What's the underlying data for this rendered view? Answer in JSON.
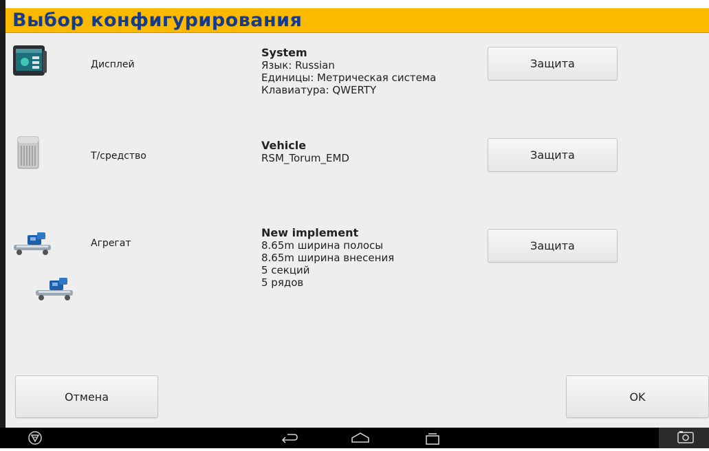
{
  "window": {
    "title": "Выбор конфигурирования"
  },
  "rows": [
    {
      "icon": "display-icon",
      "label": "Дисплей",
      "heading": "System",
      "lines": [
        "Язык: Russian",
        "Единицы: Метрическая система",
        "Клавиатура: QWERTY"
      ],
      "button": "Защита"
    },
    {
      "icon": "vehicle-icon",
      "label": "Т/средство",
      "heading": "Vehicle",
      "lines": [
        "RSM_Torum_EMD"
      ],
      "button": "Защита"
    },
    {
      "icon": "implement-icon",
      "label": "Агрегат",
      "heading": "New implement",
      "lines": [
        "8.65m ширина полосы",
        "8.65m ширина внесения",
        "5 секций",
        "5 рядов"
      ],
      "button": "Защита"
    }
  ],
  "footer": {
    "cancel_label": "Отмена",
    "ok_label": "OK"
  },
  "navbar": {
    "icons": [
      "app-logo-icon",
      "back-icon",
      "home-icon",
      "recent-apps-icon",
      "screenshot-icon"
    ]
  },
  "colors": {
    "title_bar": "#fbb900",
    "title_text": "#143b8c",
    "background": "#eeeeee"
  }
}
